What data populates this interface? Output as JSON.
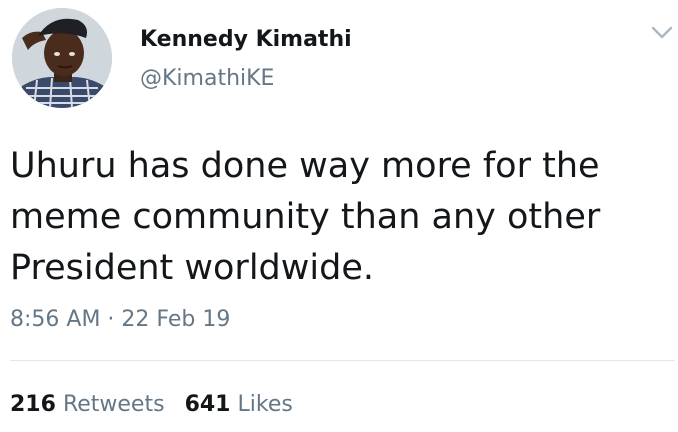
{
  "tweet": {
    "author": {
      "name": "Kennedy Kimathi",
      "handle": "@KimathiKE",
      "avatar_icon": "user-avatar"
    },
    "menu_icon": "chevron-down-icon",
    "text_lines": [
      "Uhuru has done way more for the",
      "meme community than any other",
      "President worldwide."
    ],
    "time": "8:56 AM",
    "separator": " · ",
    "date": "22 Feb 19",
    "stats": {
      "retweets_count": "216",
      "retweets_label": "Retweets",
      "likes_count": "641",
      "likes_label": "Likes"
    }
  },
  "colors": {
    "text": "#14171a",
    "secondary": "#657786",
    "divider": "#e1e8ed",
    "chevron": "#aab8c2"
  }
}
